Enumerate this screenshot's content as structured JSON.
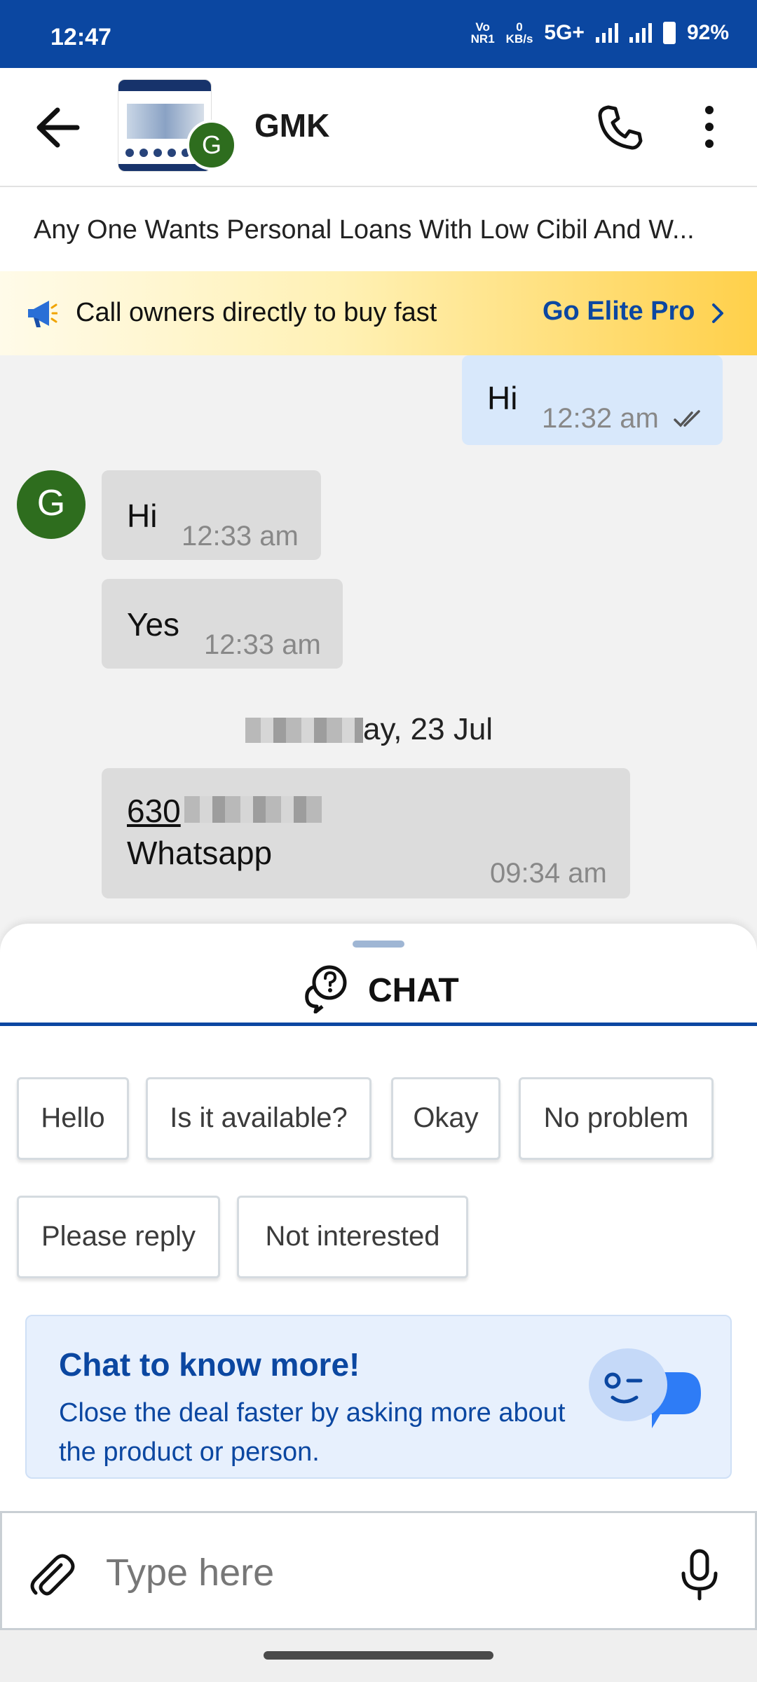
{
  "status_bar": {
    "time": "12:47",
    "volte_top": "Vo",
    "volte_bottom": "NR1",
    "speed_value": "0",
    "speed_unit": "KB/s",
    "network": "5G+",
    "battery": "92%"
  },
  "header": {
    "contact_initial": "G",
    "contact_name": "GMK"
  },
  "subject": "Any One Wants Personal Loans With Low Cibil And W...",
  "promo": {
    "text": "Call owners directly to buy fast",
    "cta": "Go Elite Pro"
  },
  "messages": [
    {
      "direction": "out",
      "text": "Hi",
      "time": "12:32 am",
      "status": "read"
    },
    {
      "direction": "in",
      "text": "Hi",
      "time": "12:33 am"
    },
    {
      "direction": "in",
      "text": "Yes",
      "time": "12:33 am"
    },
    {
      "direction": "in",
      "link": "630",
      "text": "Whatsapp",
      "time": "09:34 am"
    }
  ],
  "date_separator": "ay, 23 Jul",
  "chat_tab": {
    "label": "CHAT"
  },
  "quick_replies": [
    "Hello",
    "Is it available?",
    "Okay",
    "No problem",
    "Please reply",
    "Not interested"
  ],
  "info_card": {
    "title": "Chat to know more!",
    "body": "Close the deal faster by asking more about the product or person."
  },
  "composer": {
    "placeholder": "Type here"
  },
  "colors": {
    "brand": "#0b47a1",
    "avatar": "#2e6d1e",
    "outgoing": "#d8e8fb",
    "incoming": "#dcdcdc"
  },
  "icons": [
    "back-arrow-icon",
    "phone-icon",
    "more-vert-icon",
    "megaphone-icon",
    "chevron-right-icon",
    "double-check-icon",
    "chat-question-icon",
    "attach-icon",
    "mic-icon",
    "mascot-icon"
  ]
}
